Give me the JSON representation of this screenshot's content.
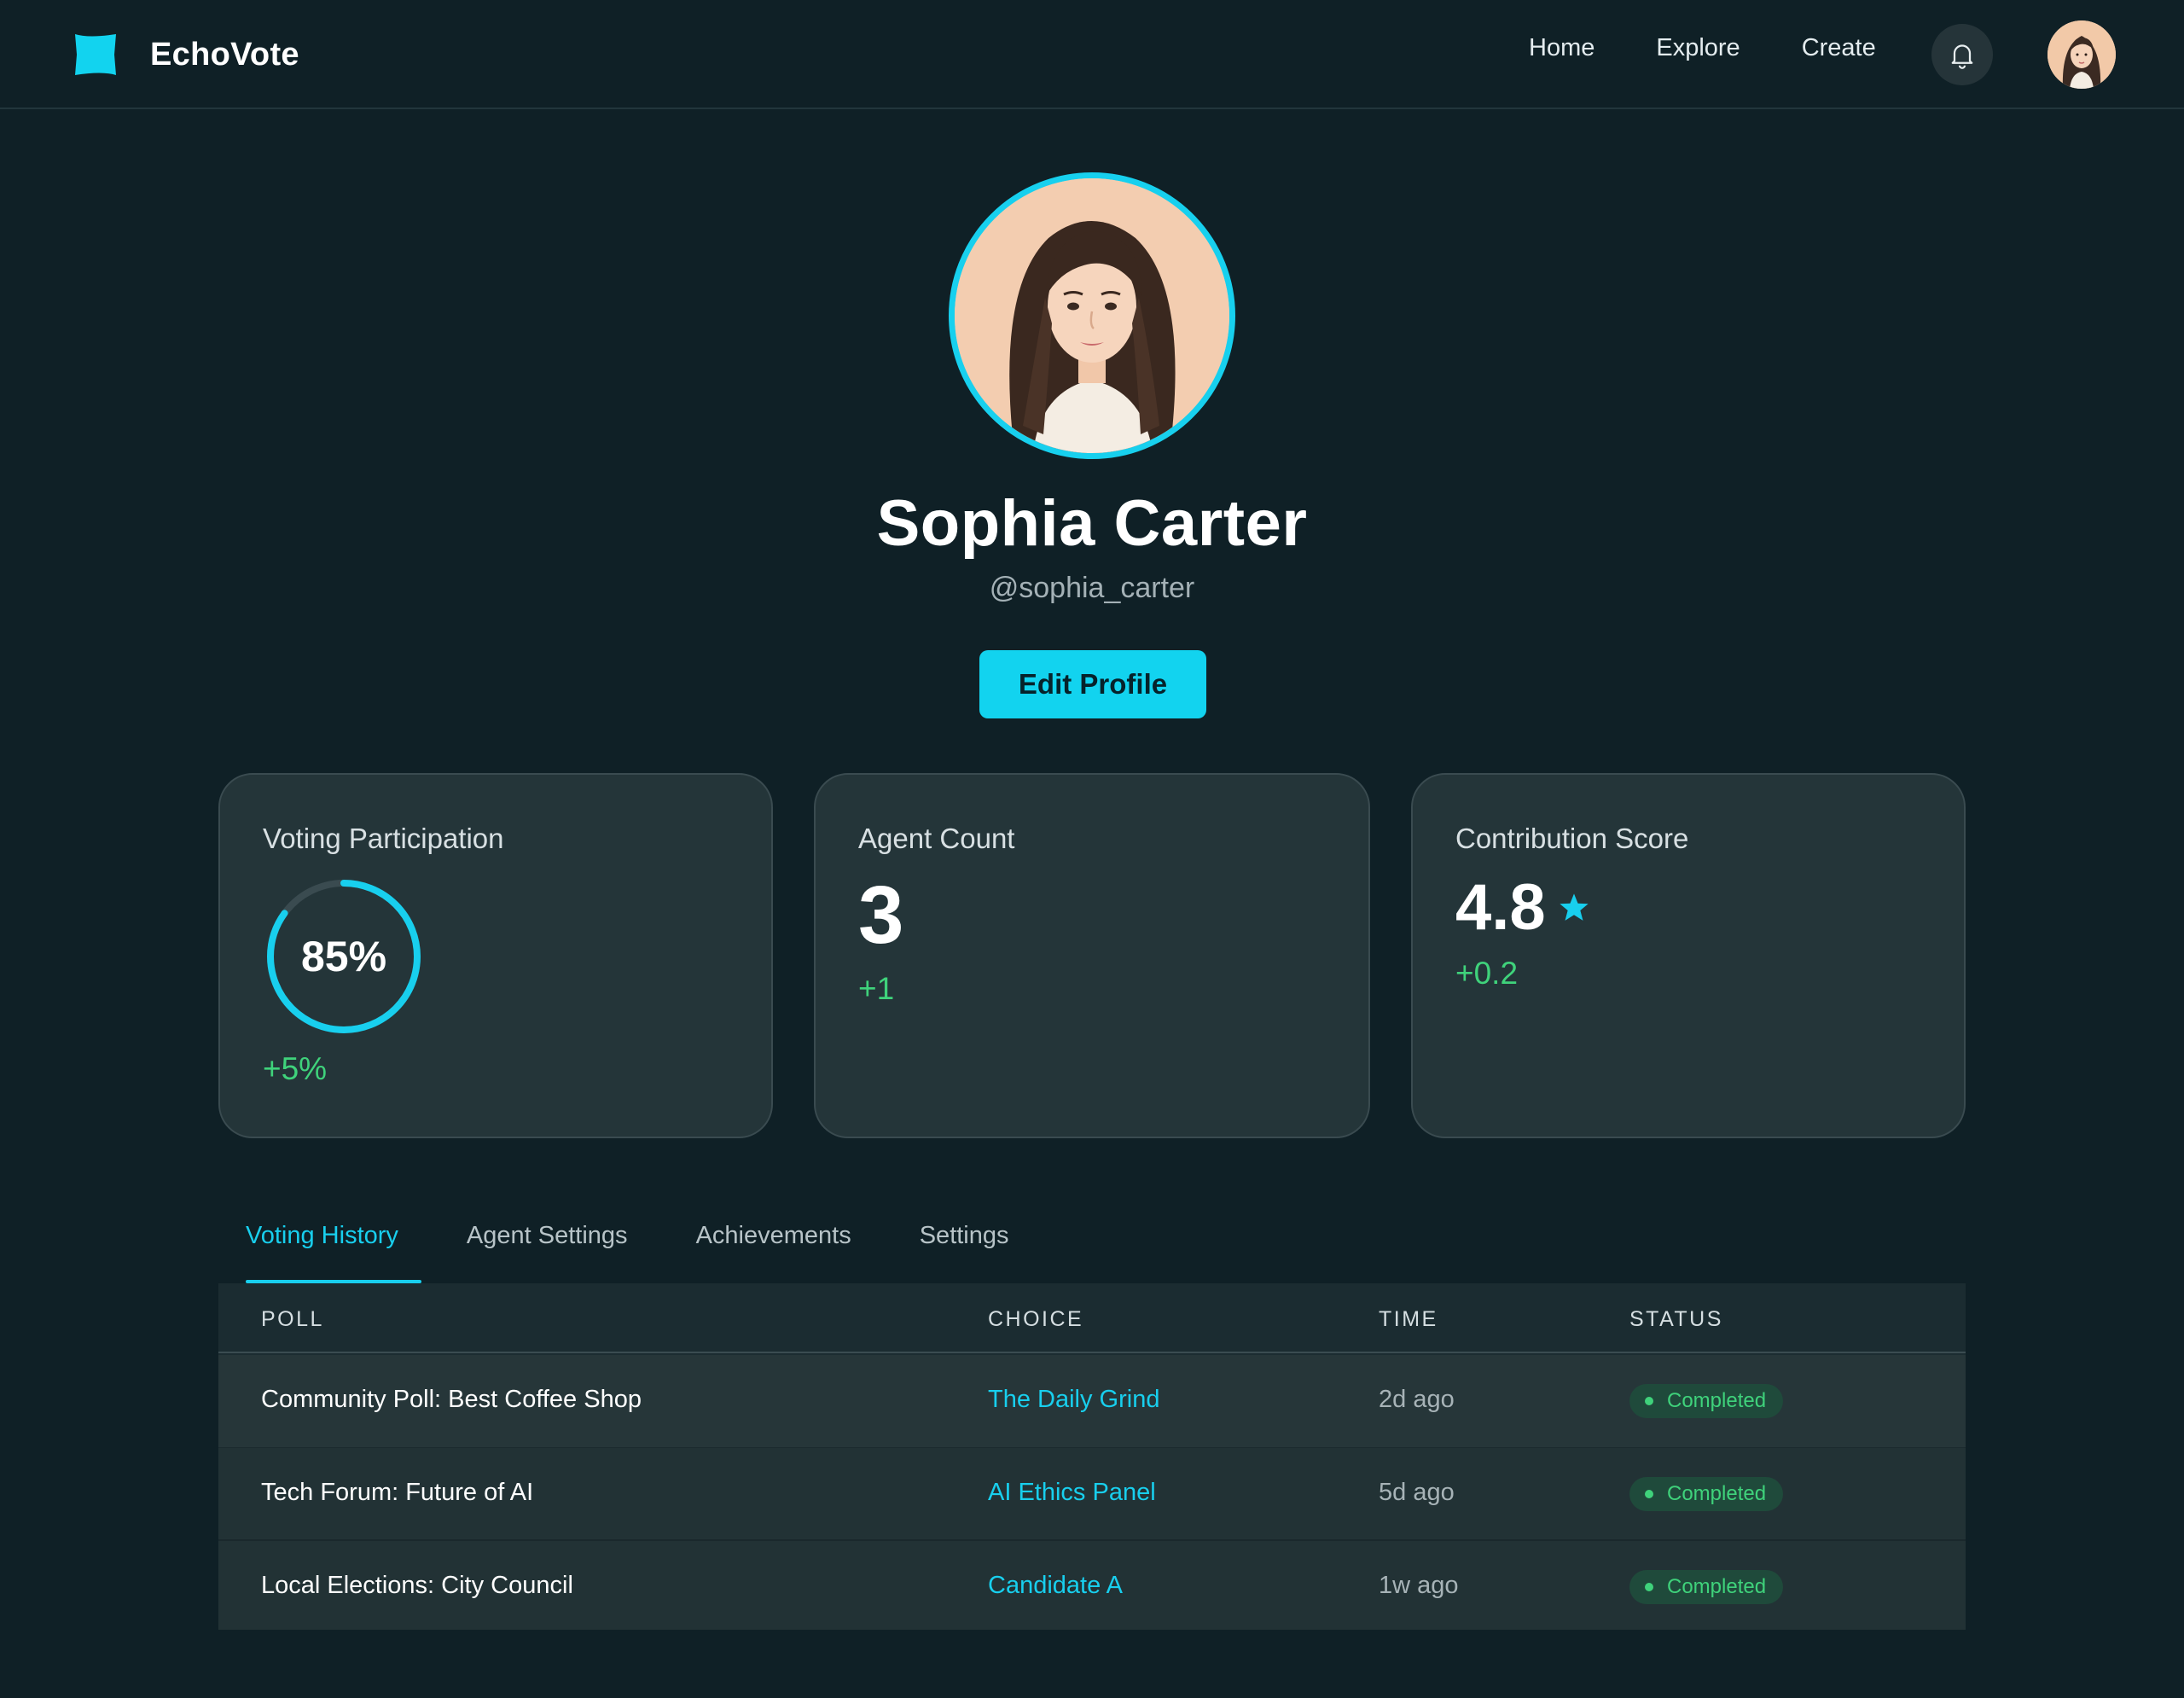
{
  "app": {
    "name": "EchoVote"
  },
  "nav": {
    "links": [
      "Home",
      "Explore",
      "Create"
    ]
  },
  "profile": {
    "name": "Sophia Carter",
    "handle": "@sophia_carter",
    "edit_label": "Edit Profile"
  },
  "stats": {
    "participation": {
      "title": "Voting Participation",
      "value": "85%",
      "percent": 85,
      "delta": "+5%"
    },
    "agents": {
      "title": "Agent Count",
      "value": "3",
      "delta": "+1"
    },
    "score": {
      "title": "Contribution Score",
      "value": "4.8",
      "delta": "+0.2"
    }
  },
  "tabs": [
    "Voting History",
    "Agent Settings",
    "Achievements",
    "Settings"
  ],
  "table": {
    "headers": [
      "POLL",
      "CHOICE",
      "TIME",
      "STATUS"
    ],
    "rows": [
      {
        "poll": "Community Poll: Best Coffee Shop",
        "choice": "The Daily Grind",
        "time": "2d ago",
        "status": "Completed"
      },
      {
        "poll": "Tech Forum: Future of AI",
        "choice": "AI Ethics Panel",
        "time": "5d ago",
        "status": "Completed"
      },
      {
        "poll": "Local Elections: City Council",
        "choice": "Candidate A",
        "time": "1w ago",
        "status": "Completed"
      }
    ]
  },
  "colors": {
    "background": "#0f2026",
    "accent": "#18cfee",
    "positive": "#3fd27b",
    "card": "#243539"
  },
  "icons": {
    "logo": "logo-icon",
    "bell": "bell-icon",
    "star": "star-icon",
    "status_dot": "status-dot-icon"
  }
}
